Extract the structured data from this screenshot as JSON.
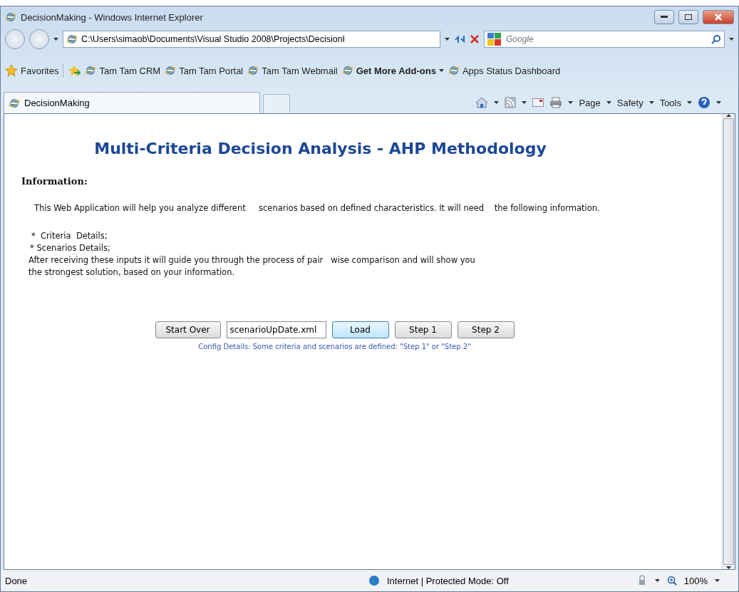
{
  "window": {
    "title": "DecisionMaking - Windows Internet Explorer"
  },
  "address_bar": {
    "value": "C:\\Users\\simaob\\Documents\\Visual Studio 2008\\Projects\\DecisionI"
  },
  "search": {
    "placeholder": "Google"
  },
  "favorites_bar": {
    "label": "Favorites",
    "links": [
      {
        "label": "Tam Tam CRM",
        "bold": false,
        "dropdown": false
      },
      {
        "label": "Tam Tam Portal",
        "bold": false,
        "dropdown": false
      },
      {
        "label": "Tam Tam Webmail",
        "bold": false,
        "dropdown": false
      },
      {
        "label": "Get More Add-ons",
        "bold": true,
        "dropdown": true
      },
      {
        "label": "Apps Status Dashboard",
        "bold": false,
        "dropdown": false
      }
    ]
  },
  "tabs": [
    {
      "label": "DecisionMaking",
      "selected": true
    }
  ],
  "command_bar": {
    "menus": [
      "Page",
      "Safety",
      "Tools"
    ]
  },
  "page": {
    "heading": "Multi-Criteria Decision Analysis - AHP Methodology",
    "section_title": "Information:",
    "intro": "This Web Application will help you analyze different     scenarios based on defined characteristics. It will need    the following information.",
    "bullets": [
      "*  Criteria  Details;",
      "* Scenarios Details;"
    ],
    "outro_lines": [
      "After receiving these inputs it will guide you through the process of pair   wise comparison and will show you",
      "the strongest solution, based on your information."
    ],
    "buttons": [
      {
        "kind": "button",
        "label": "Start Over",
        "focused": false
      },
      {
        "kind": "field",
        "value": "scenarioUpDate.xml"
      },
      {
        "kind": "button",
        "label": "Load",
        "focused": true
      },
      {
        "kind": "button",
        "label": "Step 1",
        "focused": false
      },
      {
        "kind": "button",
        "label": "Step 2",
        "focused": false
      }
    ],
    "config_note": "Config Details: Some criteria and scenarios are defined: \"Step 1\" or \"Step 2\""
  },
  "status_bar": {
    "status": "Done",
    "zone": "Internet | Protected Mode: Off",
    "zoom": "100%"
  }
}
